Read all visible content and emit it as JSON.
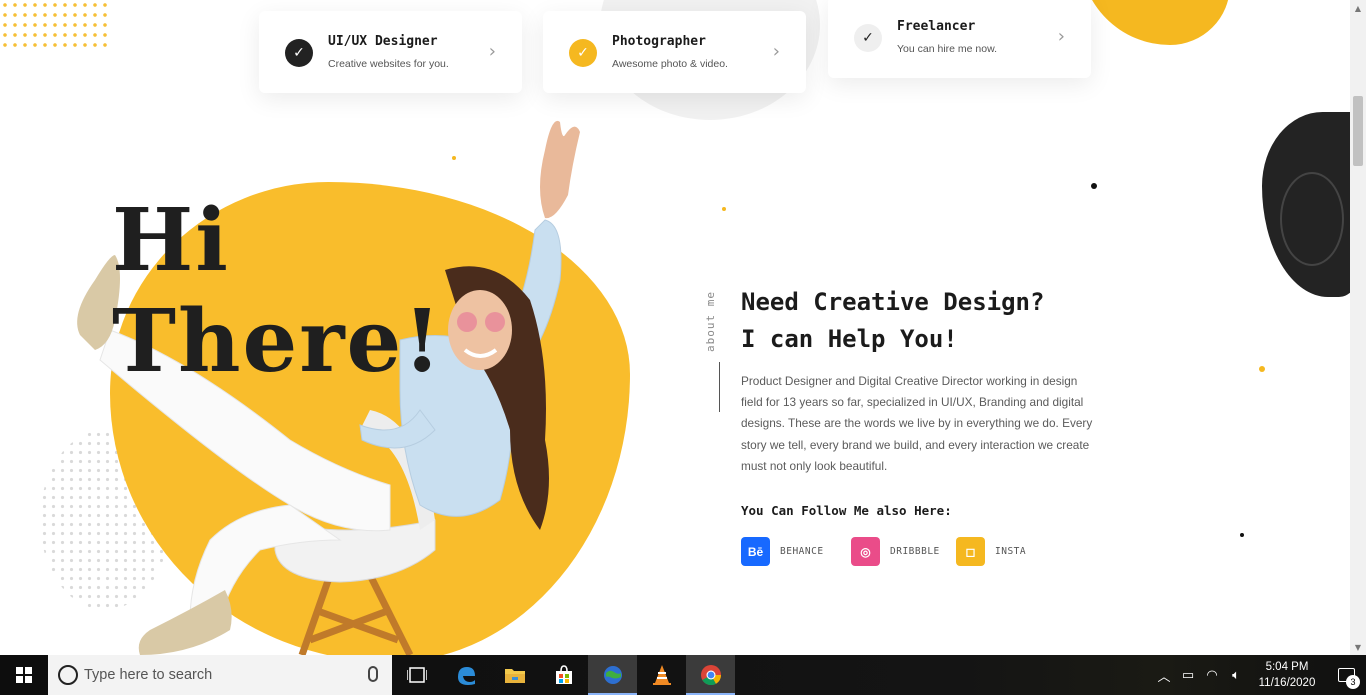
{
  "services": [
    {
      "title": "UI/UX Designer",
      "subtitle": "Creative websites for you.",
      "check_color": "#222222"
    },
    {
      "title": "Photographer",
      "subtitle": "Awesome photo & video.",
      "check_color": "#f5b820"
    },
    {
      "title": "Freelancer",
      "subtitle": "You can hire me now.",
      "check_color": "#efefef"
    }
  ],
  "hero": {
    "greeting_line1": "Hi",
    "greeting_line2": "There!"
  },
  "about": {
    "side_label": "about me",
    "heading_line1": "Need Creative Design?",
    "heading_line2": "I can Help You!",
    "paragraph": "Product Designer and Digital Creative Director working in design field for 13 years so far, specialized in UI/UX, Branding and digital designs. These are the words we live by in everything we do. Every story we tell, every brand we build, and every interaction we create must not only look beautiful.",
    "follow_title": "You Can Follow Me also Here:",
    "socials": [
      {
        "icon_text": "Bē",
        "label": "BEHANCE",
        "color": "#1769ff"
      },
      {
        "icon_text": "◎",
        "label": "DRIBBBLE",
        "color": "#ea4c89"
      },
      {
        "icon_text": "◻",
        "label": "INSTA",
        "color": "#f5b820"
      }
    ]
  },
  "taskbar": {
    "search_placeholder": "Type here to search",
    "time": "5:04 PM",
    "date": "11/16/2020",
    "notification_count": "3"
  },
  "colors": {
    "accent_yellow": "#f9bd2c",
    "dark": "#232323"
  }
}
